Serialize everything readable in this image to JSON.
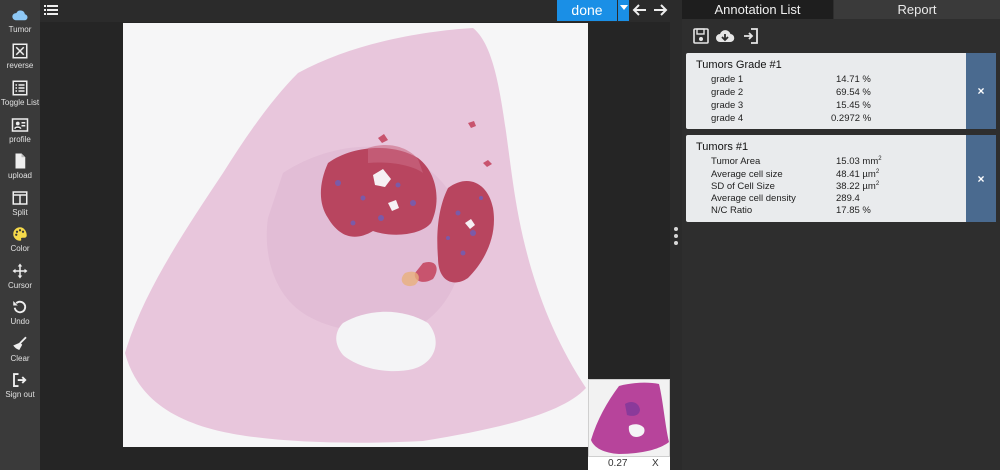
{
  "toolbar": {
    "items": [
      {
        "label": "Tumor",
        "icon": "cloud-icon"
      },
      {
        "label": "reverse",
        "icon": "reverse-icon"
      },
      {
        "label": "Toggle List",
        "icon": "list-icon"
      },
      {
        "label": "profile",
        "icon": "profile-icon"
      },
      {
        "label": "upload",
        "icon": "file-icon"
      },
      {
        "label": "Split",
        "icon": "split-icon"
      },
      {
        "label": "Color",
        "icon": "palette-icon"
      },
      {
        "label": "Cursor",
        "icon": "move-icon"
      },
      {
        "label": "Undo",
        "icon": "undo-icon"
      },
      {
        "label": "Clear",
        "icon": "broom-icon"
      },
      {
        "label": "Sign out",
        "icon": "sign-out-icon"
      }
    ]
  },
  "topbar": {
    "done_label": "done"
  },
  "minimap": {
    "zoom": "0.27",
    "close_label": "X"
  },
  "panel": {
    "tabs": {
      "annotation": "Annotation List",
      "report": "Report"
    },
    "cards": [
      {
        "title": "Tumors Grade #1",
        "rows": [
          {
            "label": "grade 1",
            "value": "14.71 %"
          },
          {
            "label": "grade 2",
            "value": "69.54 %"
          },
          {
            "label": "grade 3",
            "value": "15.45 %"
          },
          {
            "label": "grade 4",
            "value": "0.2972 %"
          }
        ],
        "close": "×"
      },
      {
        "title": "Tumors #1",
        "rows": [
          {
            "label": "Tumor Area",
            "value": "15.03 mm",
            "sup": "2"
          },
          {
            "label": "Average cell size",
            "value": "48.41 µm",
            "sup": "2"
          },
          {
            "label": "SD of Cell Size",
            "value": "38.22 µm",
            "sup": "2"
          },
          {
            "label": "Average cell density",
            "value": "289.4"
          },
          {
            "label": "N/C Ratio",
            "value": "17.85 %"
          }
        ],
        "close": "×"
      }
    ]
  },
  "colors": {
    "accent": "#1a8fe6",
    "close_button": "#4a6a8f",
    "tissue": "#e8c6dc",
    "tumor": "#c8546e",
    "highlight_icon": "#f5d94a"
  }
}
